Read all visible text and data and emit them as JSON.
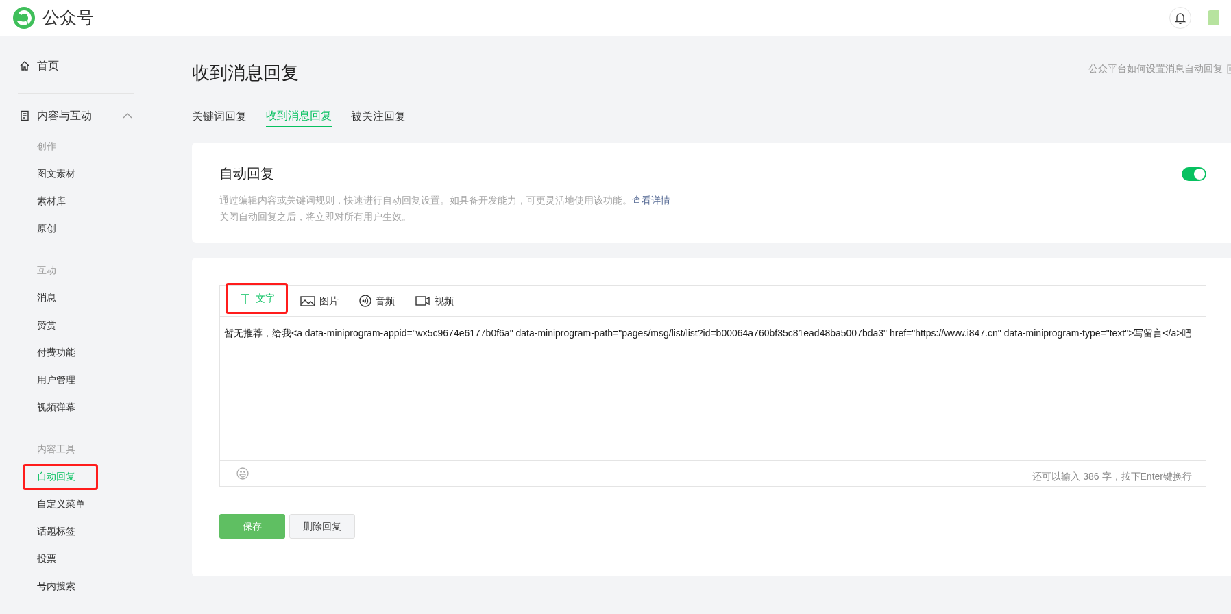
{
  "header": {
    "brand": "公众号"
  },
  "sidebar": {
    "home": "首页",
    "section": {
      "label": "内容与互动",
      "expanded": true
    },
    "groups": [
      {
        "heading": "创作",
        "items": [
          {
            "label": "图文素材",
            "selected": false,
            "highlighted": false
          },
          {
            "label": "素材库",
            "selected": false,
            "highlighted": false
          },
          {
            "label": "原创",
            "selected": false,
            "highlighted": false
          }
        ]
      },
      {
        "heading": "互动",
        "items": [
          {
            "label": "消息",
            "selected": false,
            "highlighted": false
          },
          {
            "label": "赞赏",
            "selected": false,
            "highlighted": false
          },
          {
            "label": "付费功能",
            "selected": false,
            "highlighted": false
          },
          {
            "label": "用户管理",
            "selected": false,
            "highlighted": false
          },
          {
            "label": "视频弹幕",
            "selected": false,
            "highlighted": false
          }
        ]
      },
      {
        "heading": "内容工具",
        "items": [
          {
            "label": "自动回复",
            "selected": true,
            "highlighted": true
          },
          {
            "label": "自定义菜单",
            "selected": false,
            "highlighted": false
          },
          {
            "label": "话题标签",
            "selected": false,
            "highlighted": false
          },
          {
            "label": "投票",
            "selected": false,
            "highlighted": false
          },
          {
            "label": "号内搜索",
            "selected": false,
            "highlighted": false
          }
        ]
      }
    ]
  },
  "page": {
    "title": "收到消息回复",
    "help_link": "公众平台如何设置消息自动回复"
  },
  "tabs": [
    {
      "label": "关键词回复",
      "selected": false
    },
    {
      "label": "收到消息回复",
      "selected": true
    },
    {
      "label": "被关注回复",
      "selected": false
    }
  ],
  "auto_reply": {
    "title": "自动回复",
    "on": true,
    "description": "通过编辑内容或关键词规则，快速进行自动回复设置。如具备开发能力，可更灵活地使用该功能。",
    "details_link": "查看详情",
    "note": "关闭自动回复之后，将立即对所有用户生效。"
  },
  "editor": {
    "types": [
      {
        "kind": "text",
        "label": "文字",
        "selected": true,
        "highlighted": true
      },
      {
        "kind": "image",
        "label": "图片",
        "selected": false,
        "highlighted": false
      },
      {
        "kind": "audio",
        "label": "音频",
        "selected": false,
        "highlighted": false
      },
      {
        "kind": "video",
        "label": "视频",
        "selected": false,
        "highlighted": false
      }
    ],
    "value": "暂无推荐，给我<a data-miniprogram-appid=\"wx5c9674e6177b0f6a\" data-miniprogram-path=\"pages/msg/list/list?id=b00064a760bf35c81ead48ba5007bda3\" href=\"https://www.i847.cn\" data-miniprogram-type=\"text\">写留言</a>吧",
    "counter": "还可以输入 386 字，按下Enter键换行"
  },
  "buttons": [
    {
      "kind": "primary",
      "label": "保存"
    },
    {
      "kind": "secondary",
      "label": "删除回复"
    }
  ]
}
